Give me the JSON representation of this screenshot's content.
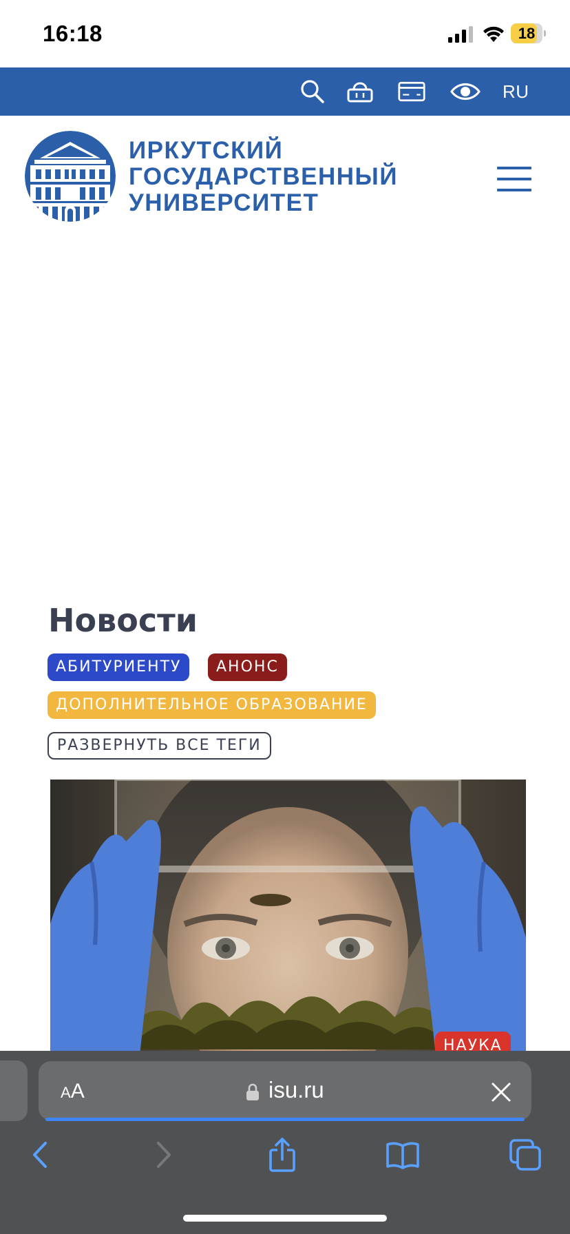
{
  "status_bar": {
    "time": "16:18",
    "battery_level": "18",
    "icons": [
      "signal-icon",
      "wifi-icon",
      "battery-icon"
    ]
  },
  "utility_bar": {
    "icons": [
      "search-icon",
      "shopping-basket-icon",
      "credit-card-icon",
      "eye-icon"
    ],
    "language": "RU",
    "background": "#2b5fa9"
  },
  "header": {
    "university_name": [
      "ИРКУТСКИЙ",
      "ГОСУДАРСТВЕННЫЙ",
      "УНИВЕРСИТЕТ"
    ],
    "brand_color": "#2b5fa9",
    "logo_icon": "university-building-logo",
    "menu_icon": "hamburger-menu-icon"
  },
  "news": {
    "title": "Новости",
    "tags": [
      {
        "label": "АБИТУРИЕНТУ",
        "color": "#2b49c9"
      },
      {
        "label": "АНОНС",
        "color": "#8b1c1c"
      },
      {
        "label": "ДОПОЛНИТЕЛЬНОЕ ОБРАЗОВАНИЕ",
        "color": "#f1b73e"
      }
    ],
    "expand_tags_label": "РАЗВЕРНУТЬ ВСЕ ТЕГИ",
    "first_item": {
      "category": "НАУКА",
      "category_color": "#d8342c"
    }
  },
  "browser": {
    "text_size_label_small": "A",
    "text_size_label_big": "A",
    "url": "isu.ru",
    "toolbar_icons": [
      "back-icon",
      "forward-icon",
      "share-icon",
      "bookmarks-icon",
      "tabs-icon"
    ]
  }
}
